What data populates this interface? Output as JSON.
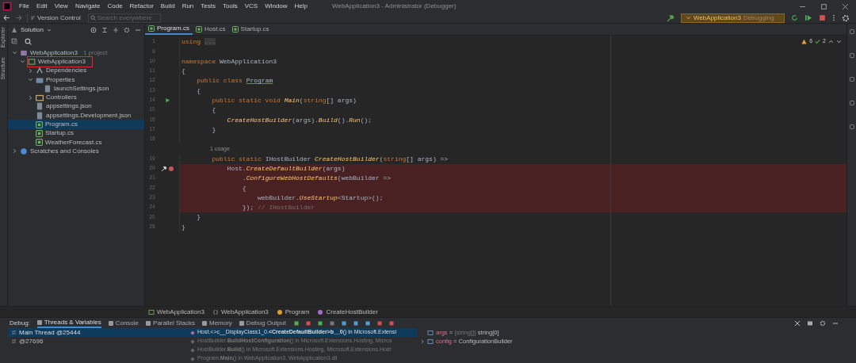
{
  "menu": [
    "File",
    "Edit",
    "View",
    "Navigate",
    "Code",
    "Refactor",
    "Build",
    "Run",
    "Tests",
    "Tools",
    "VCS",
    "Window",
    "Help"
  ],
  "window": {
    "title": "WebApplication3 - Administrator (Debugger)"
  },
  "toolbar": {
    "version_control": "Version Control",
    "search": {
      "placeholder": "Search everywhere"
    },
    "run_config": {
      "name": "WebApplication3",
      "state": "Debugging"
    }
  },
  "left_strip": [
    "Explorer",
    "Structure"
  ],
  "explorer": {
    "title": "Solution",
    "tree": [
      {
        "label": "WebApplication3",
        "suffix": "1 project",
        "kind": "solution",
        "expanded": true,
        "selected": false,
        "children": [
          {
            "label": "WebApplication3",
            "kind": "project",
            "expanded": true,
            "selected": false,
            "outlined": true,
            "children": [
              {
                "label": "Dependencies",
                "kind": "dependencies",
                "expanded": false,
                "selected": false
              },
              {
                "label": "Properties",
                "kind": "properties",
                "expanded": true,
                "selected": false,
                "children": [
                  {
                    "label": "launchSettings.json",
                    "kind": "json",
                    "selected": false
                  }
                ]
              },
              {
                "label": "Controllers",
                "kind": "folder",
                "expanded": false,
                "selected": false
              },
              {
                "label": "appsettings.json",
                "kind": "json",
                "selected": false
              },
              {
                "label": "appsettings.Development.json",
                "kind": "json",
                "selected": false
              },
              {
                "label": "Program.cs",
                "kind": "cs",
                "selected": true
              },
              {
                "label": "Startup.cs",
                "kind": "cs",
                "selected": false
              },
              {
                "label": "WeatherForecast.cs",
                "kind": "cs",
                "selected": false
              }
            ]
          }
        ]
      },
      {
        "label": "Scratches and Consoles",
        "kind": "scratches",
        "expanded": false,
        "selected": false
      }
    ]
  },
  "editor": {
    "tabs": [
      {
        "label": "Program.cs",
        "selected": true
      },
      {
        "label": "Host.cs",
        "selected": false
      },
      {
        "label": "Startup.cs",
        "selected": false
      }
    ],
    "inspections": {
      "warnings": "6",
      "passed": "2"
    },
    "lines": [
      {
        "number": "1",
        "kind": "code",
        "highlighted": false,
        "tokens": [
          {
            "text": "using ",
            "kind": "keyword"
          },
          {
            "text": "...",
            "kind": "fold"
          }
        ]
      },
      {
        "number": "9",
        "kind": "code",
        "highlighted": false
      },
      {
        "number": "10",
        "kind": "code",
        "highlighted": false,
        "tokens": [
          {
            "text": "namespace ",
            "kind": "keyword"
          },
          {
            "text": "WebApplication3",
            "kind": "plain"
          }
        ]
      },
      {
        "number": "11",
        "kind": "code",
        "highlighted": false,
        "tokens": [
          {
            "text": "{",
            "kind": "plain"
          }
        ]
      },
      {
        "number": "12",
        "kind": "code",
        "highlighted": false,
        "tokens": [
          {
            "text": "    public class ",
            "kind": "keyword"
          },
          {
            "text": "Program",
            "kind": "class"
          }
        ]
      },
      {
        "number": "13",
        "kind": "code",
        "highlighted": false,
        "tokens": [
          {
            "text": "    {",
            "kind": "plain"
          }
        ]
      },
      {
        "number": "14",
        "kind": "run",
        "highlighted": false,
        "tokens": [
          {
            "text": "        public static void ",
            "kind": "keyword"
          },
          {
            "text": "Main",
            "kind": "method"
          },
          {
            "text": "(",
            "kind": "plain"
          },
          {
            "text": "string",
            "kind": "keyword"
          },
          {
            "text": "[] args)",
            "kind": "plain"
          }
        ]
      },
      {
        "number": "15",
        "kind": "code",
        "highlighted": false,
        "tokens": [
          {
            "text": "        {",
            "kind": "plain"
          }
        ]
      },
      {
        "number": "16",
        "kind": "code",
        "highlighted": false,
        "tokens": [
          {
            "text": "            CreateHostBuilder",
            "kind": "method"
          },
          {
            "text": "(args).",
            "kind": "plain"
          },
          {
            "text": "Build",
            "kind": "method"
          },
          {
            "text": "().",
            "kind": "plain"
          },
          {
            "text": "Run",
            "kind": "method"
          },
          {
            "text": "();",
            "kind": "plain"
          }
        ]
      },
      {
        "number": "17",
        "kind": "code",
        "highlighted": false,
        "tokens": [
          {
            "text": "        }",
            "kind": "plain"
          }
        ]
      },
      {
        "number": "18",
        "kind": "code",
        "highlighted": false
      },
      {
        "kind": "hint",
        "text": "1 usage"
      },
      {
        "number": "19",
        "kind": "code",
        "highlighted": false,
        "tokens": [
          {
            "text": "        public static ",
            "kind": "keyword"
          },
          {
            "text": "IHostBuilder ",
            "kind": "plain"
          },
          {
            "text": "CreateHostBuilder",
            "kind": "method"
          },
          {
            "text": "(",
            "kind": "plain"
          },
          {
            "text": "string",
            "kind": "keyword"
          },
          {
            "text": "[] args) =>",
            "kind": "plain"
          }
        ]
      },
      {
        "number": "20",
        "kind": "breakpoint",
        "highlighted": true,
        "tokens": [
          {
            "text": "            Host.",
            "kind": "plain"
          },
          {
            "text": "CreateDefaultBuilder",
            "kind": "method"
          },
          {
            "text": "(args)",
            "kind": "plain"
          }
        ]
      },
      {
        "number": "21",
        "kind": "code",
        "highlighted": true,
        "tokens": [
          {
            "text": "                .",
            "kind": "plain"
          },
          {
            "text": "ConfigureWebHostDefaults",
            "kind": "method"
          },
          {
            "text": "(webBuilder =>",
            "kind": "plain"
          }
        ]
      },
      {
        "number": "22",
        "kind": "code",
        "highlighted": true,
        "tokens": [
          {
            "text": "                {",
            "kind": "plain"
          }
        ]
      },
      {
        "number": "23",
        "kind": "code",
        "highlighted": true,
        "tokens": [
          {
            "text": "                    webBuilder.",
            "kind": "plain"
          },
          {
            "text": "UseStartup",
            "kind": "method"
          },
          {
            "text": "<Startup>();",
            "kind": "plain"
          }
        ]
      },
      {
        "number": "24",
        "kind": "code",
        "highlighted": true,
        "tokens": [
          {
            "text": "                }); ",
            "kind": "plain"
          },
          {
            "text": "// IHostBuilder",
            "kind": "comment"
          }
        ]
      },
      {
        "number": "25",
        "kind": "code",
        "highlighted": false,
        "tokens": [
          {
            "text": "    }",
            "kind": "plain"
          }
        ]
      },
      {
        "number": "26",
        "kind": "code",
        "highlighted": false,
        "tokens": [
          {
            "text": "}",
            "kind": "plain"
          }
        ]
      }
    ]
  },
  "breadcrumbs": [
    {
      "label": "WebApplication3",
      "kind": "project"
    },
    {
      "label": "WebApplication3",
      "kind": "namespace"
    },
    {
      "label": "Program",
      "kind": "class"
    },
    {
      "label": "CreateHostBuilder",
      "kind": "method"
    }
  ],
  "debug": {
    "title": "Debug:",
    "tabs": [
      {
        "label": "Threads & Variables",
        "selected": true
      },
      {
        "label": "Console",
        "selected": false
      },
      {
        "label": "Parallel Stacks",
        "selected": false
      },
      {
        "label": "Memory",
        "selected": false
      },
      {
        "label": "Debug Output",
        "selected": false
      }
    ],
    "threads": [
      {
        "label": "Main Thread @25444",
        "selected": true
      },
      {
        "label": "@27696",
        "selected": false
      }
    ],
    "frames": [
      {
        "text": "Host.<>c__DisplayClass1_0.**<CreateDefaultBuilder>b__0**() in Microsoft.Extensi",
        "selected": true
      },
      {
        "text": "HostBuilder.**BuildHostConfiguration**() in Microsoft.Extensions.Hosting, Micros",
        "selected": false
      },
      {
        "text": "HostBuilder.**Build**() in Microsoft.Extensions.Hosting, Microsoft.Extensions.Host",
        "selected": false
      },
      {
        "text": "Program.**Main**() in WebApplication3, WebApplication3.dll",
        "selected": false
      }
    ],
    "variables": [
      {
        "name": "args",
        "operator": "=",
        "type": "{string[]}",
        "value": "string[0]"
      },
      {
        "name": "config",
        "operator": "=",
        "value": "ConfigurationBuilder",
        "expanded": false
      }
    ]
  }
}
